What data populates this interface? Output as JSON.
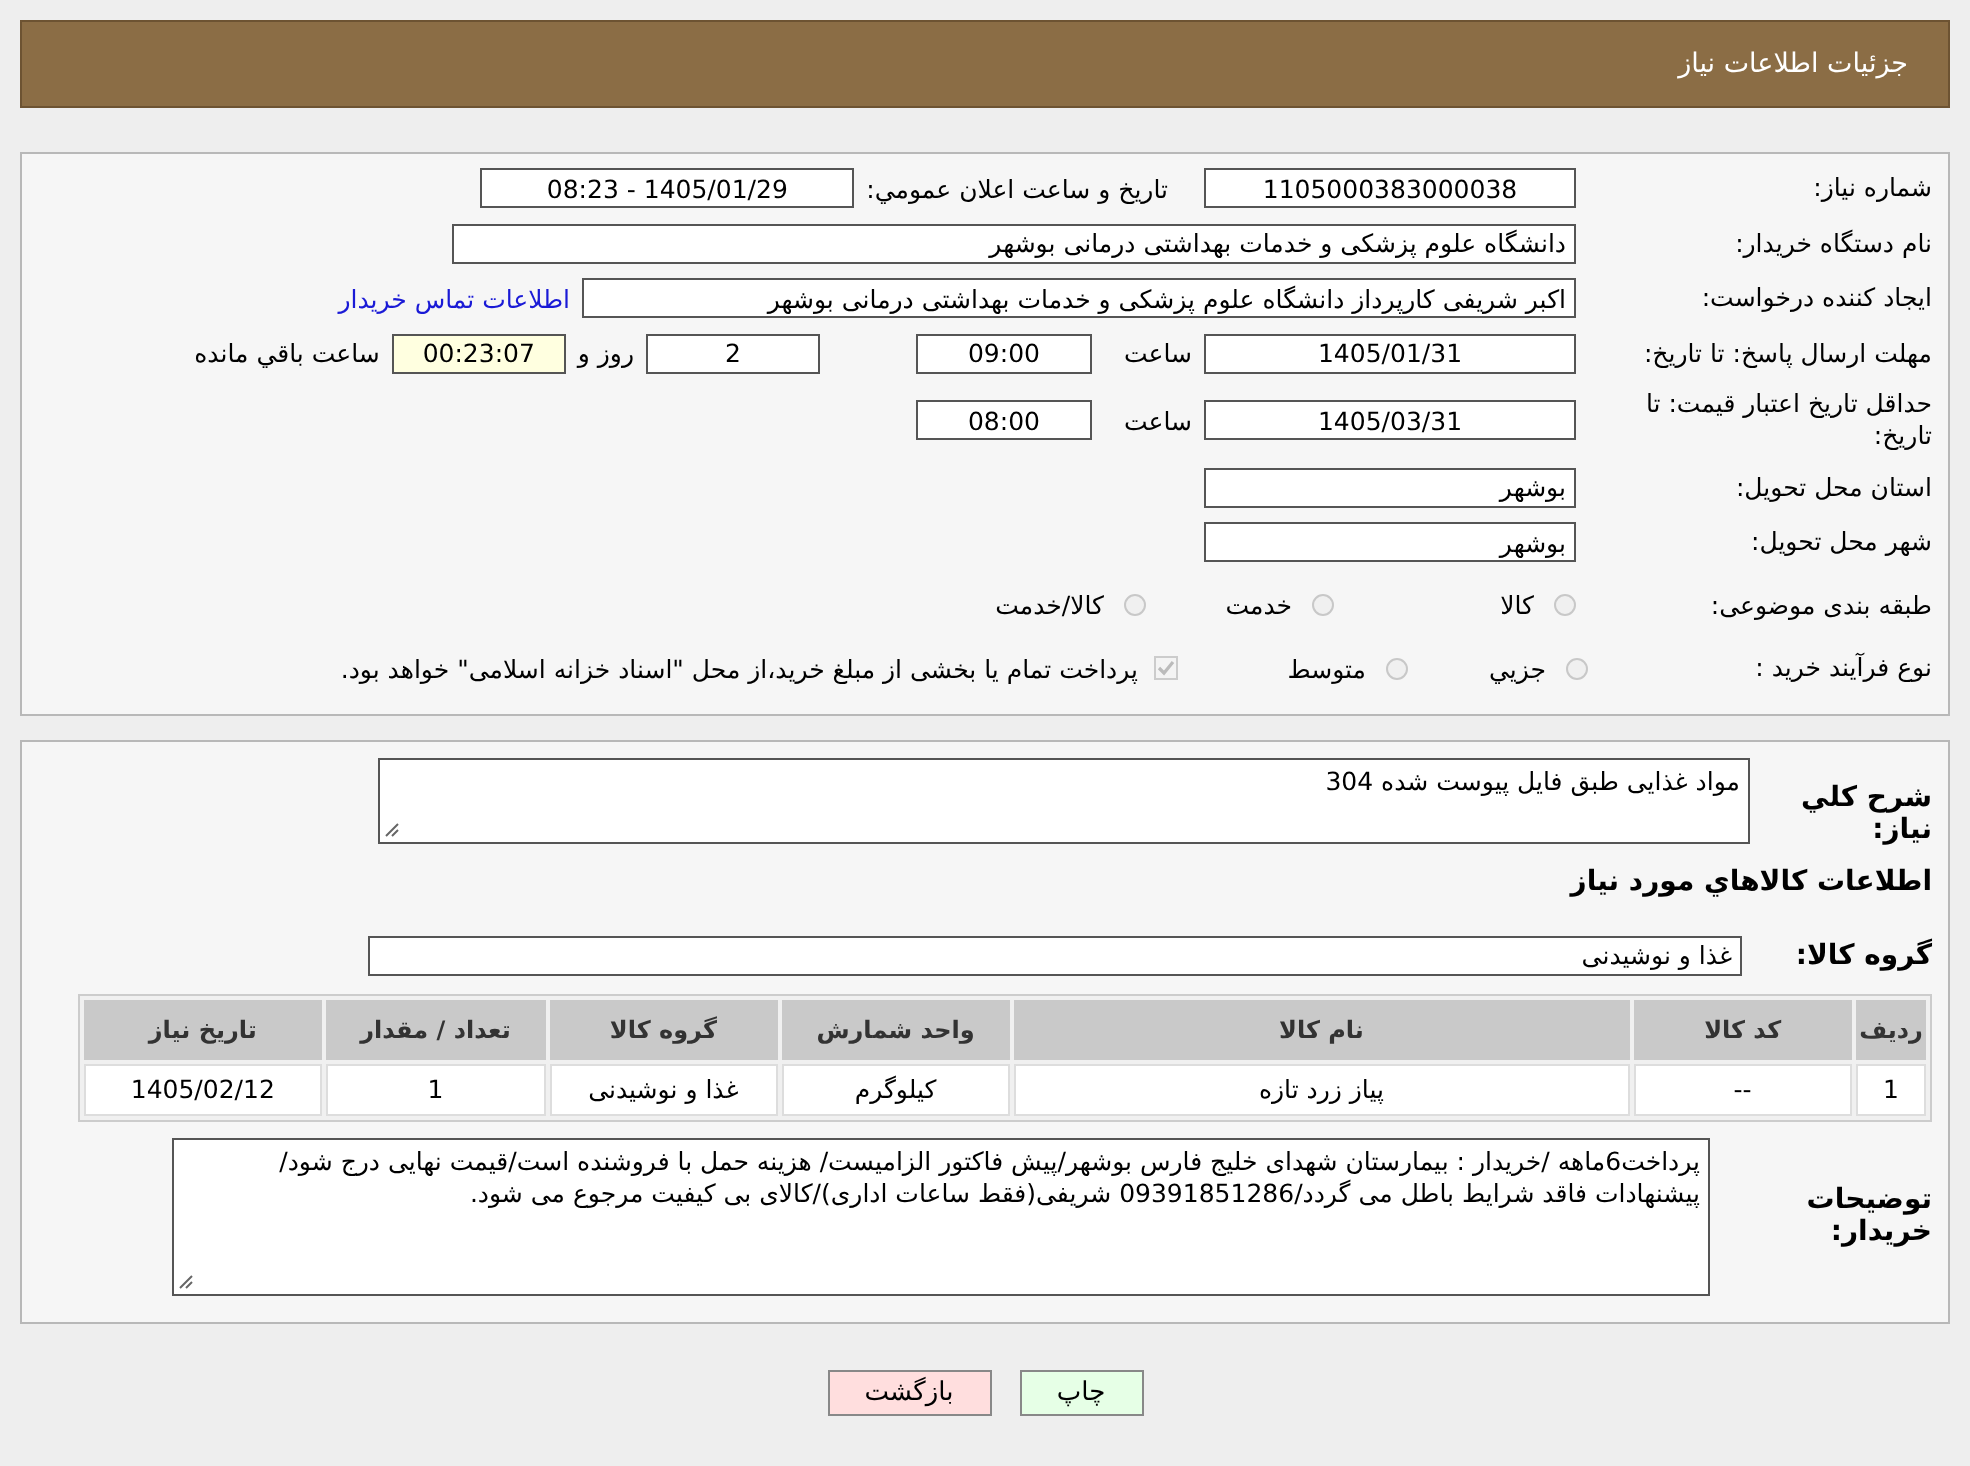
{
  "header": {
    "title": "جزئیات اطلاعات نیاز"
  },
  "need_number": {
    "label": "شماره نیاز:",
    "value": "1105000383000038"
  },
  "announce": {
    "label": "تاریخ و ساعت اعلان عمومي:",
    "value": "1405/01/29 - 08:23"
  },
  "buyer_org": {
    "label": "نام دستگاه خریدار:",
    "value": "دانشگاه علوم پزشکی و خدمات بهداشتی درمانی بوشهر"
  },
  "creator": {
    "label": "ایجاد کننده درخواست:",
    "value": "اکبر شریفی کارپرداز دانشگاه علوم پزشکی و خدمات بهداشتی درمانی بوشهر",
    "link": "اطلاعات تماس خریدار"
  },
  "deadline": {
    "label": "مهلت ارسال پاسخ: تا تاریخ:",
    "date": "1405/01/31",
    "time_label": "ساعت",
    "time": "09:00",
    "days": "2",
    "days_label": "روز و",
    "remaining": "00:23:07",
    "remaining_label": "ساعت باقي مانده"
  },
  "validity": {
    "label": "حداقل تاریخ اعتبار قیمت: تا تاریخ:",
    "date": "1405/03/31",
    "time_label": "ساعت",
    "time": "08:00"
  },
  "province": {
    "label": "استان محل تحویل:",
    "value": "بوشهر"
  },
  "city": {
    "label": "شهر محل تحویل:",
    "value": "بوشهر"
  },
  "category": {
    "label": "طبقه بندی موضوعی:",
    "options": [
      {
        "label": "کالا",
        "selected": false
      },
      {
        "label": "خدمت",
        "selected": false
      },
      {
        "label": "کالا/خدمت",
        "selected": false
      }
    ]
  },
  "process": {
    "label": "نوع فرآیند خرید :",
    "options": [
      {
        "label": "جزيي",
        "selected": false
      },
      {
        "label": "متوسط",
        "selected": false
      }
    ],
    "payment": {
      "label": "پرداخت تمام یا بخشی از مبلغ خرید،از محل \"اسناد خزانه اسلامی\" خواهد بود.",
      "checked": true
    }
  },
  "description": {
    "label": "شرح کلي نیاز:",
    "value": "مواد غذایی  طبق فایل پیوست شده 304"
  },
  "goods_heading": "اطلاعات کالاهاي مورد نیاز",
  "goods_group": {
    "label": "گروه کالا:",
    "value": "غذا و نوشیدنی"
  },
  "table": {
    "columns": [
      "ردیف",
      "کد کالا",
      "نام کالا",
      "واحد شمارش",
      "گروه کالا",
      "تعداد / مقدار",
      "تاریخ نیاز"
    ],
    "rows": [
      [
        "1",
        "--",
        "پیاز زرد تازه",
        "کیلوگرم",
        "غذا و نوشیدنی",
        "1",
        "1405/02/12"
      ]
    ]
  },
  "buyer_notes": {
    "label": "توضیحات خریدار:",
    "value": "پرداخت6ماهه /خریدار : بیمارستان شهدای خلیج فارس بوشهر/پیش فاکتور الزامیست/ هزینه حمل با فروشنده است/قیمت نهایی درج شود/پیشنهادات فاقد شرایط باطل می گردد/09391851286 شریفی(فقط ساعات اداری)/کالای بی کیفیت مرجوع می شود."
  },
  "buttons": [
    {
      "label": "چاپ",
      "kind": "print"
    },
    {
      "label": "بازگشت",
      "kind": "back"
    }
  ]
}
